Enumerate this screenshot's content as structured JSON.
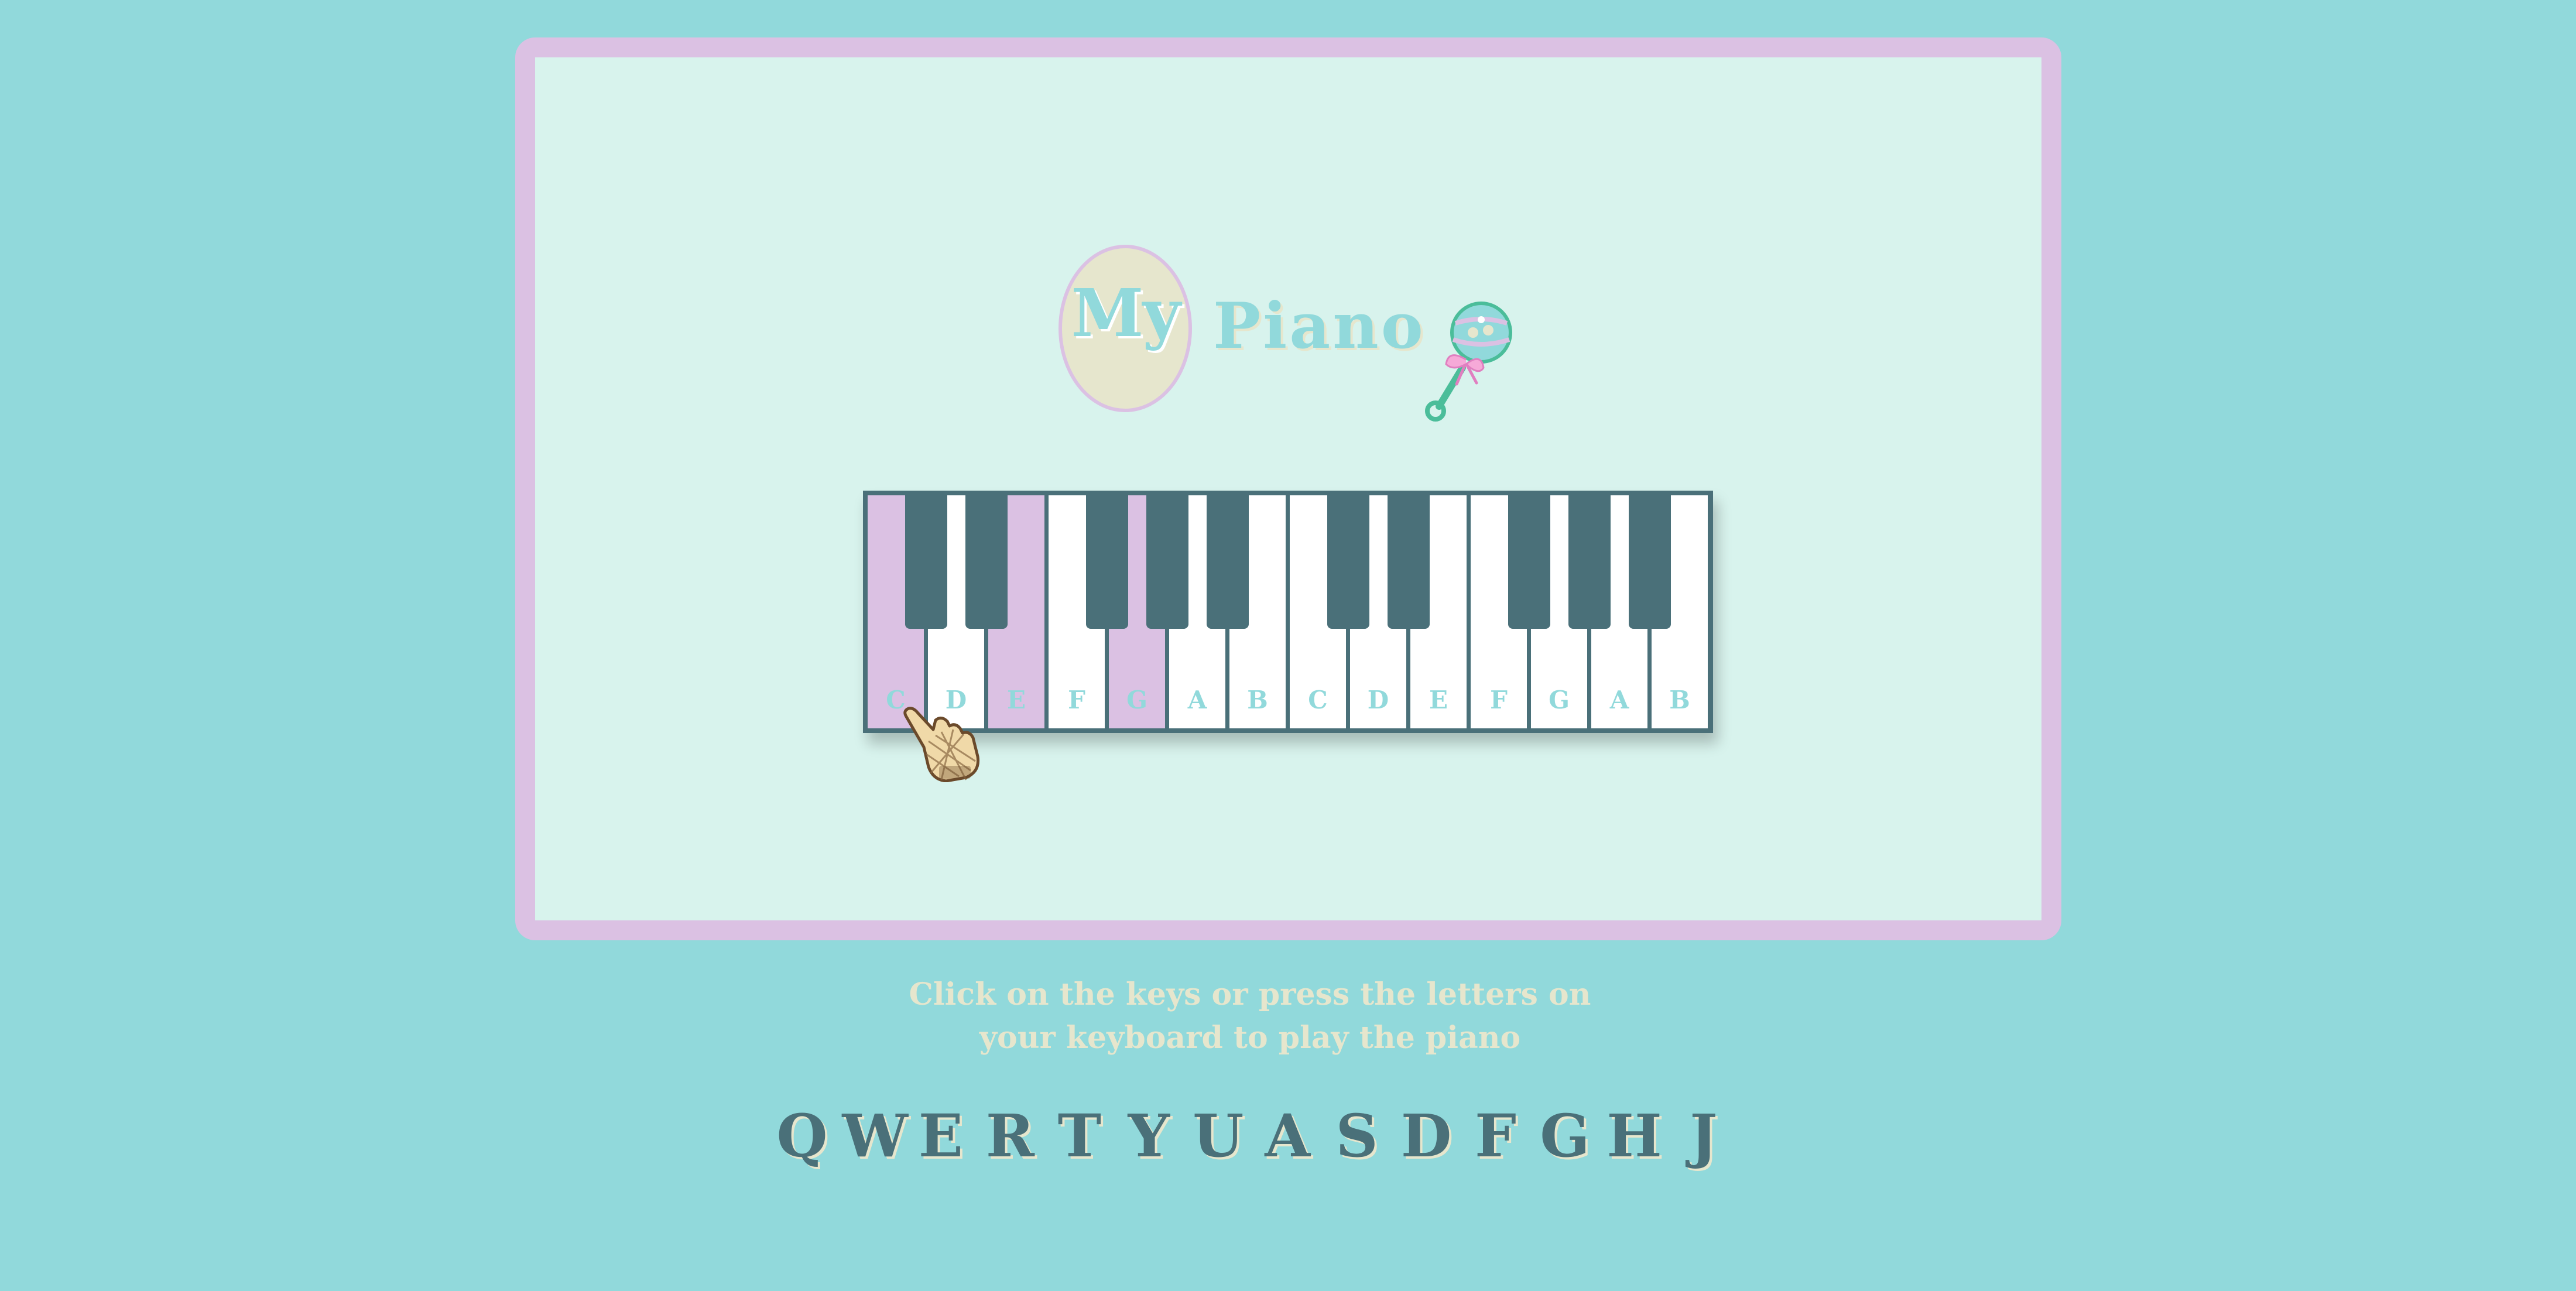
{
  "logo": {
    "my": "My",
    "piano": "Piano"
  },
  "piano": {
    "white_keys": [
      {
        "note": "C",
        "active": true
      },
      {
        "note": "D",
        "active": false
      },
      {
        "note": "E",
        "active": true
      },
      {
        "note": "F",
        "active": false
      },
      {
        "note": "G",
        "active": true
      },
      {
        "note": "A",
        "active": false
      },
      {
        "note": "B",
        "active": false
      },
      {
        "note": "C",
        "active": false
      },
      {
        "note": "D",
        "active": false
      },
      {
        "note": "E",
        "active": false
      },
      {
        "note": "F",
        "active": false
      },
      {
        "note": "G",
        "active": false
      },
      {
        "note": "A",
        "active": false
      },
      {
        "note": "B",
        "active": false
      }
    ]
  },
  "instructions": {
    "line1": "Click on the keys or press the letters on",
    "line2": "your keyboard to play the piano"
  },
  "keyboard_letters": [
    "Q",
    "W",
    "E",
    "R",
    "T",
    "Y",
    "U",
    "A",
    "S",
    "D",
    "F",
    "G",
    "H",
    "J"
  ],
  "colors": {
    "background": "#91d9db",
    "frame": "#dbc1e3",
    "stage": "#d8f3ed",
    "dark_teal": "#4a7079",
    "cream": "#e6e6cd",
    "active_key": "#dbc1e3"
  },
  "icons": {
    "rattle": "baby-rattle-icon",
    "cursor": "pointing-hand-cursor-icon"
  }
}
